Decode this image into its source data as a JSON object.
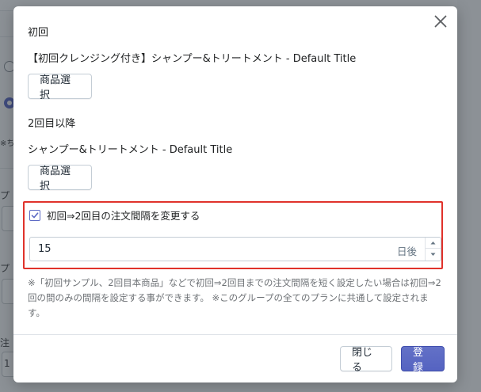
{
  "background": {
    "fragment_note": "※ち",
    "fragment_a": "プ",
    "fragment_b": "プ",
    "fragment_c": "注",
    "fragment_d": "1"
  },
  "modal": {
    "first_label": "初回",
    "first_product": "【初回クレンジング付き】シャンプー&トリートメント - Default Title",
    "select_product_1": "商品選択",
    "second_label": "2回目以降",
    "second_product": "シャンプー&トリートメント - Default Title",
    "select_product_2": "商品選択",
    "change_interval": {
      "checked": true,
      "label": "初回⇒2回目の注文間隔を変更する"
    },
    "interval_value": "15",
    "interval_unit": "日後",
    "help_text": "※「初回サンプル、2回目本商品」などで初回⇒2回目までの注文間隔を短く設定したい場合は初回⇒2回の間のみの間隔を設定する事ができます。 ※このグループの全てのプランに共通して設定されます。",
    "footer": {
      "close_label": "閉じる",
      "submit_label": "登録"
    }
  },
  "colors": {
    "primary": "#5c6ac4",
    "highlight_border": "#e0322b",
    "overlay": "#212b36"
  },
  "icons": {
    "close": "close-icon",
    "checkbox": "checkmark-icon",
    "step_up": "caret-up-icon",
    "step_down": "caret-down-icon"
  }
}
